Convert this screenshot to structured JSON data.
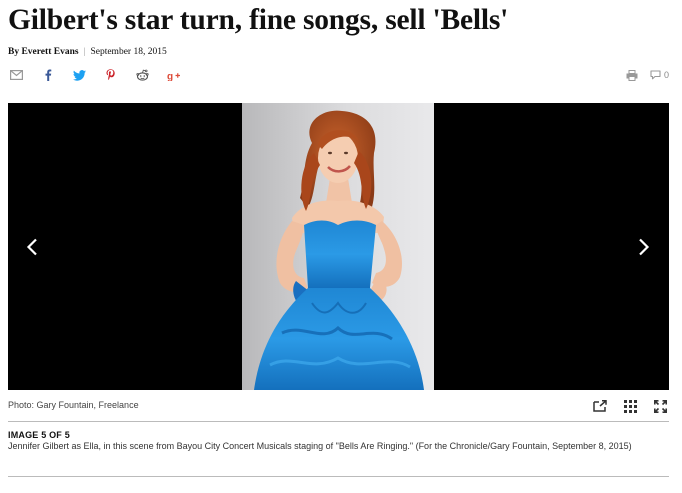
{
  "article": {
    "headline": "Gilbert's star turn, fine songs, sell 'Bells'",
    "byline": {
      "author": "By Everett Evans",
      "separator": "|",
      "date": "September 18, 2015"
    }
  },
  "share": {
    "icons": [
      "email-icon",
      "facebook-icon",
      "twitter-icon",
      "pinterest-icon",
      "reddit-icon",
      "google-plus-icon"
    ],
    "colors": {
      "email": "#999999",
      "facebook": "#3b5998",
      "twitter": "#1da1f2",
      "pinterest": "#cb2027",
      "reddit": "#555555",
      "google_plus": "#dd4b39"
    }
  },
  "tools": {
    "print_icon": "print-icon",
    "comment_icon": "comment-icon",
    "comment_count": "0"
  },
  "gallery": {
    "photo_alt": "photo",
    "credit": "Photo: Gary Fountain, Freelance",
    "counter": "IMAGE 5 OF 5",
    "caption": "Jennifer Gilbert as Ella, in this scene from Bayou City Concert Musicals staging of \"Bells Are Ringing.\" (For the Chronicle/Gary Fountain, September 8, 2015)",
    "icons": [
      "external-link-icon",
      "grid-icon",
      "fullscreen-icon"
    ]
  }
}
